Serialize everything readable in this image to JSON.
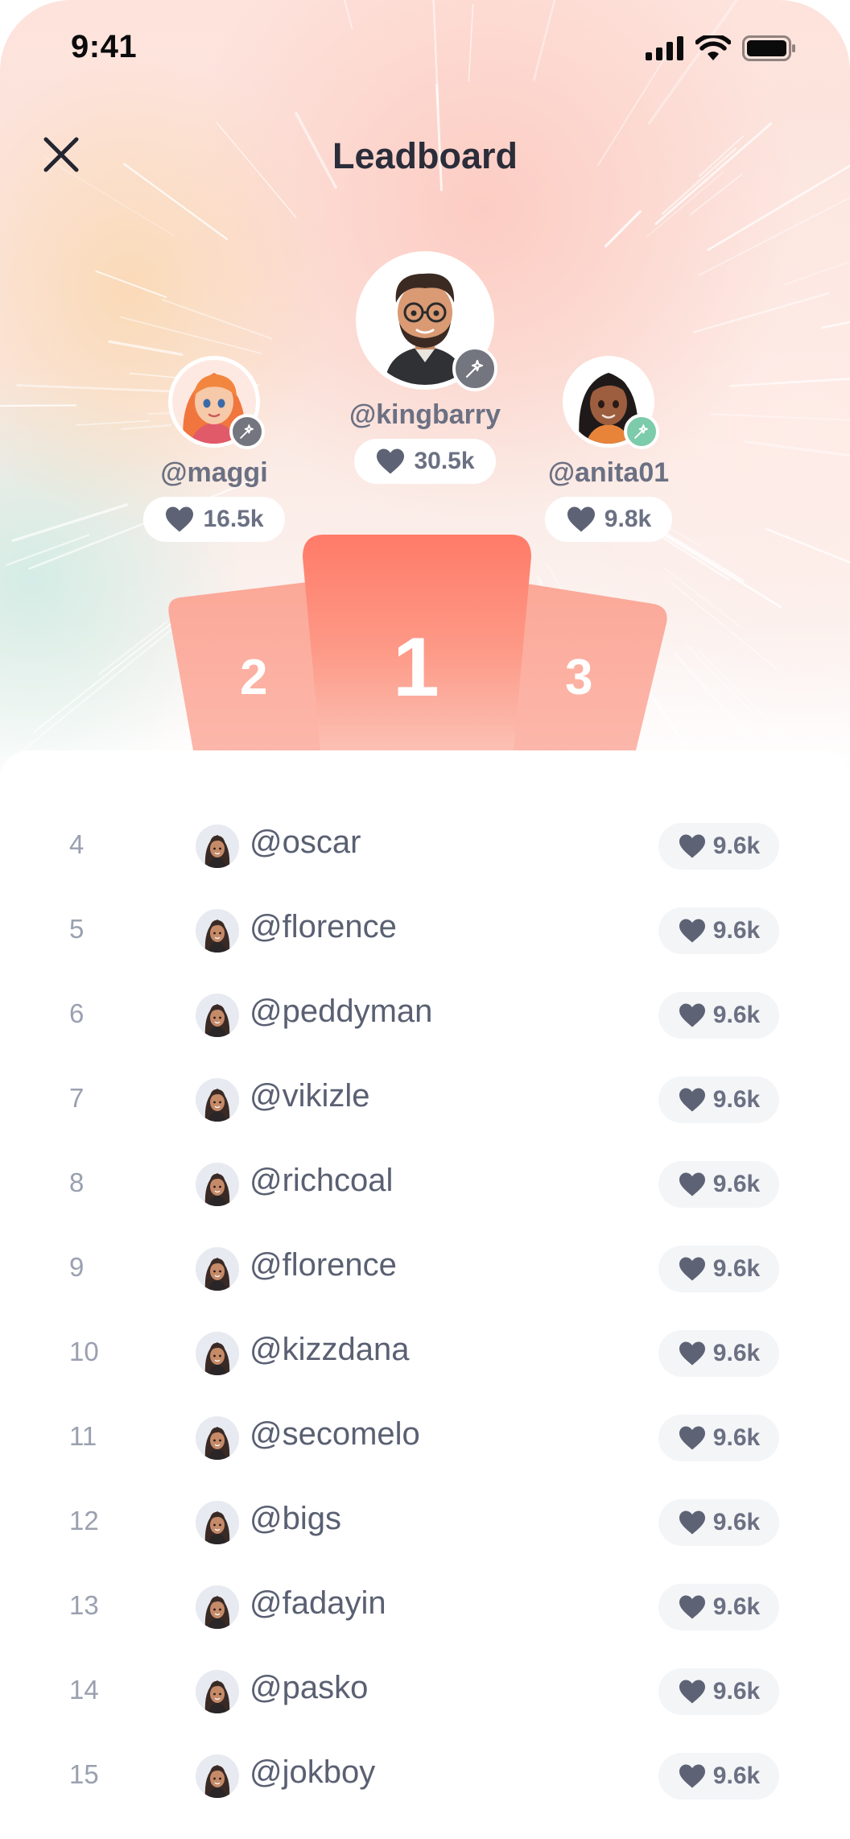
{
  "status_bar": {
    "time": "9:41"
  },
  "header": {
    "title": "Leadboard"
  },
  "podium": {
    "first": {
      "username": "@kingbarry",
      "likes": "30.5k",
      "rank_label": "1"
    },
    "second": {
      "username": "@maggi",
      "likes": "16.5k",
      "rank_label": "2"
    },
    "third": {
      "username": "@anita01",
      "likes": "9.8k",
      "rank_label": "3"
    }
  },
  "leaderboard": [
    {
      "rank": "4",
      "username": "@oscar",
      "likes": "9.6k"
    },
    {
      "rank": "5",
      "username": "@florence",
      "likes": "9.6k"
    },
    {
      "rank": "6",
      "username": "@peddyman",
      "likes": "9.6k"
    },
    {
      "rank": "7",
      "username": "@vikizle",
      "likes": "9.6k"
    },
    {
      "rank": "8",
      "username": "@richcoal",
      "likes": "9.6k"
    },
    {
      "rank": "9",
      "username": "@florence",
      "likes": "9.6k"
    },
    {
      "rank": "10",
      "username": "@kizzdana",
      "likes": "9.6k"
    },
    {
      "rank": "11",
      "username": "@secomelo",
      "likes": "9.6k"
    },
    {
      "rank": "12",
      "username": "@bigs",
      "likes": "9.6k"
    },
    {
      "rank": "13",
      "username": "@fadayin",
      "likes": "9.6k"
    },
    {
      "rank": "14",
      "username": "@pasko",
      "likes": "9.6k"
    },
    {
      "rank": "15",
      "username": "@jokboy",
      "likes": "9.6k"
    }
  ],
  "icons": {
    "close": "close-icon",
    "heart": "heart-icon",
    "badge": "magic-wand-icon",
    "signal": "cellular-signal-icon",
    "wifi": "wifi-icon",
    "battery": "battery-icon"
  },
  "colors": {
    "podium_primary": "#ff7d6a",
    "podium_secondary": "#fbb0a2",
    "text_muted": "#6b7083",
    "rank_text": "#9aa0b0"
  }
}
